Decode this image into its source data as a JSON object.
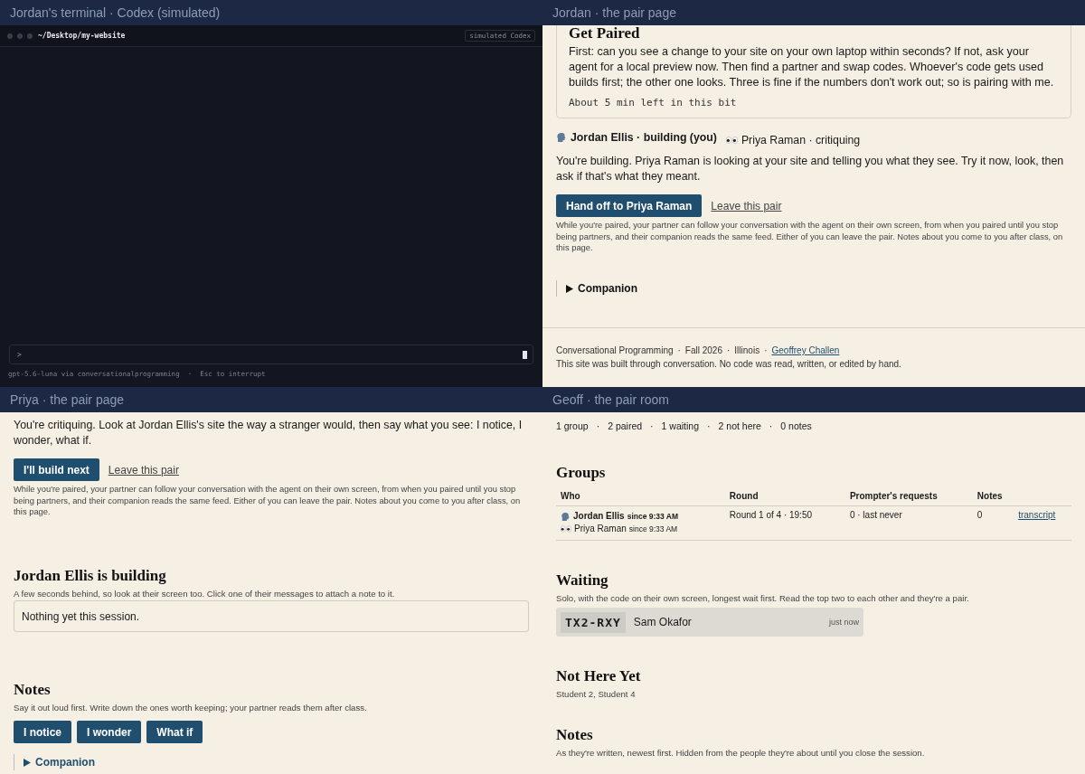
{
  "terminal": {
    "title": "Jordan's terminal · Codex (simulated)",
    "path": "~/Desktop/my-website",
    "badge": "simulated Codex",
    "prompt": ">",
    "footer": "gpt-5.6-luna via conversationalprogramming  ·  Esc to interrupt"
  },
  "jordan_page": {
    "title": "Jordan · the pair page",
    "card": {
      "heading": "Get Paired",
      "body": "First: can you see a change to your site on your own laptop within seconds? If not, ask your agent for a local preview now. Then find a partner and swap codes. Whoever's code gets used builds first; the other one looks. Three is fine if the numbers don't work out; so is pairing with me.",
      "timer": "About 5 min left in this bit"
    },
    "roles": [
      {
        "kind": "speaking",
        "label": "Jordan Ellis · building (you)",
        "you": true
      },
      {
        "kind": "eyes",
        "label": "Priya Raman · critiquing",
        "you": false
      }
    ],
    "intro": "You're building. Priya Raman is looking at your site and telling you what they see. Try it now, look, then ask if that's what they meant.",
    "primary_button": "Hand off to Priya Raman",
    "link": "Leave this pair",
    "fine_print": "While you're paired, your partner can follow your conversation with the agent on their own screen, from when you paired until you stop being partners, and their companion reads the same feed. Either of you can leave the pair. Notes about you come to you after class, on this page.",
    "companion": {
      "label": "Companion",
      "expanded": false
    },
    "footer": {
      "credits": [
        "Conversational Programming",
        "Fall 2026",
        "Illinois"
      ],
      "separator": "·",
      "author": "Geoffrey Challen",
      "note": "This site was built through conversation. No code was read, written, or edited by hand."
    }
  },
  "priya_page": {
    "title": "Priya · the pair page",
    "intro": "You're critiquing. Look at Jordan Ellis's site the way a stranger would, then say what you see: I notice, I wonder, what if.",
    "primary_button": "I'll build next",
    "link": "Leave this pair",
    "fine_print": "While you're paired, your partner can follow your conversation with the agent on their own screen, from when you paired until you stop being partners, and their companion reads the same feed. Either of you can leave the pair. Notes about you come to you after class, on this page.",
    "feed": {
      "heading": "Jordan Ellis is building",
      "description": "A few seconds behind, so look at their screen too. Click one of their messages to attach a note to it.",
      "empty": "Nothing yet this session."
    },
    "notes": {
      "heading": "Notes",
      "description": "Say it out loud first. Write down the ones worth keeping; your partner reads them after class.",
      "buttons": [
        "I notice",
        "I wonder",
        "What if"
      ]
    },
    "companion": {
      "label": "Companion",
      "expanded": false
    }
  },
  "geoff_room": {
    "title": "Geoff · the pair room",
    "stats": [
      "1 group",
      "2 paired",
      "1 waiting",
      "2 not here",
      "0 notes"
    ],
    "separator": "·",
    "groups": {
      "heading": "Groups",
      "columns": [
        "Who",
        "Round",
        "Prompter's requests",
        "Notes"
      ],
      "rows": [
        {
          "members": [
            {
              "kind": "speaking",
              "name": "Jordan Ellis",
              "since": "since 9:33 AM",
              "building": true
            },
            {
              "kind": "eyes",
              "name": "Priya Raman",
              "since": "since 9:33 AM",
              "building": false
            }
          ],
          "round": "Round 1 of 4 · 19:50",
          "requests": "0 · last never",
          "notes": "0",
          "link": "transcript"
        }
      ]
    },
    "waiting": {
      "heading": "Waiting",
      "description": "Solo, with the code on their own screen, longest wait first. Read the top two to each other and they're a pair.",
      "queue": [
        {
          "code": "TX2-RXY",
          "name": "Sam Okafor",
          "time": "just now"
        }
      ]
    },
    "not_here": {
      "heading": "Not Here Yet",
      "names": "Student 2, Student 4"
    },
    "notes": {
      "heading": "Notes",
      "description": "As they're written, newest first. Hidden from the people they're about until you close the session."
    }
  }
}
